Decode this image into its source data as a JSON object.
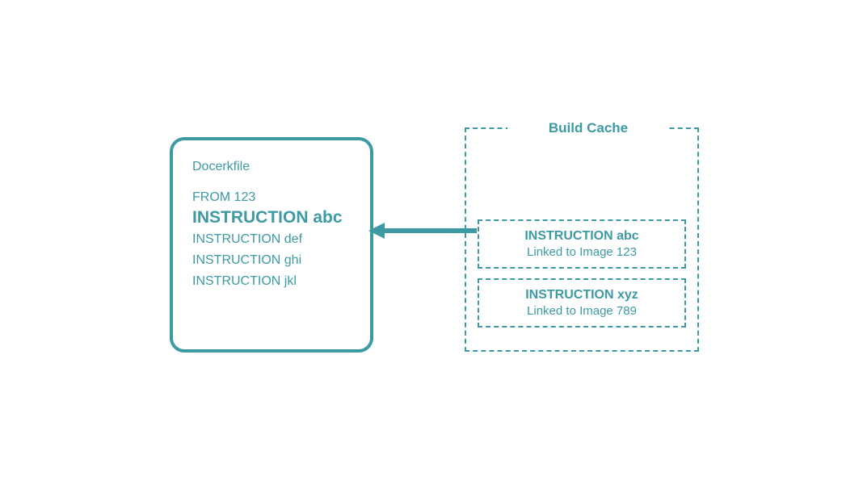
{
  "dockerfile": {
    "title": "Docerkfile",
    "from": "FROM 123",
    "highlighted": "INSTRUCTION abc",
    "lines": [
      "INSTRUCTION def",
      "INSTRUCTION ghi",
      "INSTRUCTION jkl"
    ]
  },
  "cache": {
    "title": "Build Cache",
    "entries": [
      {
        "inst": "INSTRUCTION abc",
        "link": "Linked to Image 123"
      },
      {
        "inst": "INSTRUCTION xyz",
        "link": "Linked to Image 789"
      }
    ]
  },
  "colors": {
    "primary": "#3d9aa3"
  }
}
